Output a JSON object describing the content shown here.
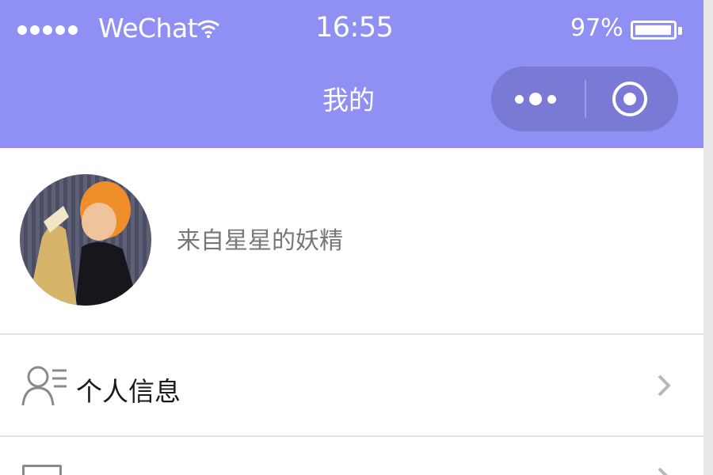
{
  "status_bar": {
    "carrier": "WeChat",
    "time": "16:55",
    "battery_percent": "97%",
    "battery_level": 0.97,
    "signal_dots": 5
  },
  "nav": {
    "title": "我的"
  },
  "profile": {
    "nickname": "来自星星的妖精"
  },
  "menu": {
    "items": [
      {
        "label": "个人信息",
        "icon": "person-icon"
      },
      {
        "label": "",
        "icon": "document-icon"
      }
    ]
  },
  "colors": {
    "header": "#9090f4",
    "capsule": "#7a7ad6"
  }
}
